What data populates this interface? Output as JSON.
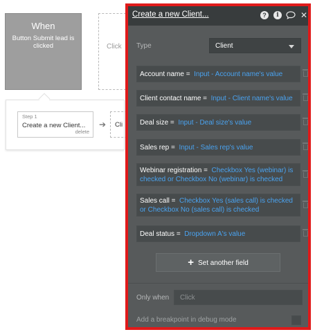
{
  "canvas": {
    "event": {
      "title": "When",
      "description": "Button Submit lead is clicked"
    },
    "next_event_placeholder": "Click",
    "step": {
      "label": "Step 1",
      "title": "Create a new Client...",
      "delete": "delete"
    },
    "next_step_placeholder": "Cli"
  },
  "panel": {
    "title": "Create a new Client...",
    "icons": [
      "question-icon",
      "info-icon",
      "comment-icon",
      "close-icon"
    ],
    "type": {
      "label": "Type",
      "value": "Client"
    },
    "fields": [
      {
        "name": "Account name",
        "eq": "=",
        "expr": "Input - Account name's value"
      },
      {
        "name": "Client contact name",
        "eq": "=",
        "expr": "Input - Client name's value"
      },
      {
        "name": "Deal size",
        "eq": "=",
        "expr": "Input - Deal size's value"
      },
      {
        "name": "Sales rep",
        "eq": "=",
        "expr": "Input - Sales rep's value"
      },
      {
        "name": "Webinar registration",
        "eq": "=",
        "expr": "Checkbox Yes (webinar) is checked or Checkbox No (webinar) is checked"
      },
      {
        "name": "Sales call",
        "eq": "=",
        "expr": "Checkbox Yes (sales call) is checked or Checkbox No (sales call) is checked"
      },
      {
        "name": "Deal status",
        "eq": "=",
        "expr": "Dropdown A's value"
      }
    ],
    "set_another_field": "Set another field",
    "only_when": {
      "label": "Only when",
      "placeholder": "Click"
    },
    "breakpoint_label": "Add a breakpoint in debug mode"
  },
  "colors": {
    "highlight_border": "#e01a1a",
    "expression": "#4aa3f0",
    "panel_bg": "#575a5b",
    "header_bg": "#383c3d"
  }
}
